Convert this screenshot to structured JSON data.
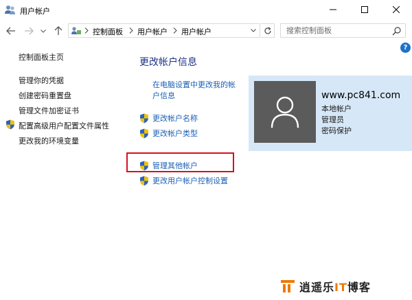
{
  "window": {
    "title": "用户帐户"
  },
  "address_bar": {
    "breadcrumbs": [
      "控制面板",
      "用户帐户",
      "用户帐户"
    ]
  },
  "search": {
    "placeholder": "搜索控制面板"
  },
  "help": {
    "label": "?"
  },
  "sidebar": {
    "home": "控制面板主页",
    "items": [
      {
        "label": "管理你的凭据"
      },
      {
        "label": "创建密码重置盘"
      },
      {
        "label": "管理文件加密证书"
      },
      {
        "label": "配置高级用户配置文件属性"
      },
      {
        "label": "更改我的环境变量"
      }
    ]
  },
  "main": {
    "title": "更改帐户信息",
    "pc_settings_link": "在电脑设置中更改我的帐户信息",
    "change_name": "更改帐户名称",
    "change_type": "更改帐户类型",
    "manage_other": "管理其他帐户",
    "uac_settings": "更改用户帐户控制设置"
  },
  "account": {
    "name": "www.pc841.com",
    "type": "本地帐户",
    "role": "管理员",
    "password": "密码保护"
  },
  "watermark": {
    "prefix": "逍遥乐",
    "it": "IT",
    "suffix": "博客"
  },
  "colors": {
    "link": "#1a5fb4",
    "title": "#1e3287",
    "highlight": "#d4101f",
    "card_bg": "#d6e8f7",
    "avatar_bg": "#5b5b5b",
    "watermark_accent": "#f07800"
  },
  "icons": {
    "app": "users-icon",
    "shield": "uac-shield-icon",
    "avatar": "user-silhouette-icon"
  }
}
